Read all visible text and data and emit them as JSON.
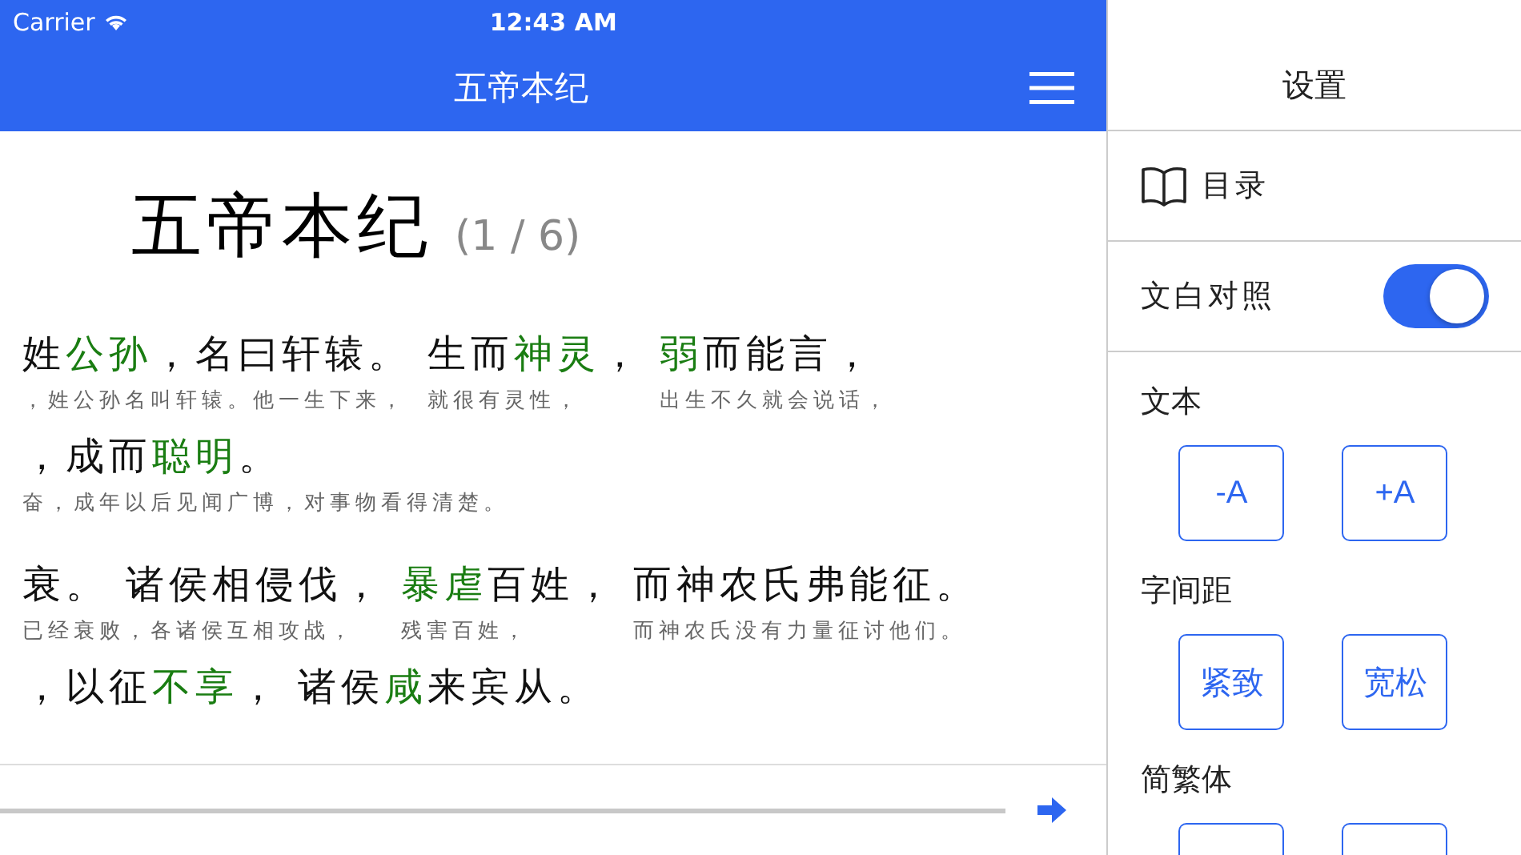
{
  "status_bar": {
    "carrier": "Carrier",
    "time": "12:43 AM"
  },
  "nav_bar": {
    "title": "五帝本纪"
  },
  "article": {
    "title": "五帝本纪",
    "page": "(1 / 6)",
    "paragraphs": [
      {
        "lines": [
          {
            "segments": [
              {
                "parts": [
                  {
                    "text": "姓",
                    "annotated": false
                  },
                  {
                    "text": "公孙",
                    "annotated": true
                  },
                  {
                    "text": "，名曰轩辕。",
                    "annotated": false
                  }
                ],
                "gloss": "，姓公孙名叫轩辕。他一生下来，"
              },
              {
                "parts": [
                  {
                    "text": "生而",
                    "annotated": false
                  },
                  {
                    "text": "神灵",
                    "annotated": true
                  },
                  {
                    "text": "，",
                    "annotated": false
                  }
                ],
                "gloss": "就很有灵性，"
              },
              {
                "parts": [
                  {
                    "text": "弱",
                    "annotated": true
                  },
                  {
                    "text": "而能言，",
                    "annotated": false
                  }
                ],
                "gloss": "出生不久就会说话，"
              }
            ]
          },
          {
            "segments": [
              {
                "parts": [
                  {
                    "text": "，成而",
                    "annotated": false
                  },
                  {
                    "text": "聪明",
                    "annotated": true
                  },
                  {
                    "text": "。",
                    "annotated": false
                  }
                ],
                "gloss": "奋，成年以后见闻广博，对事物看得清楚。"
              }
            ]
          }
        ]
      },
      {
        "lines": [
          {
            "segments": [
              {
                "parts": [
                  {
                    "text": "衰。 诸侯相侵伐，",
                    "annotated": false
                  }
                ],
                "gloss": "已经衰败，各诸侯互相攻战，"
              },
              {
                "parts": [
                  {
                    "text": "暴虐",
                    "annotated": true
                  },
                  {
                    "text": "百姓，",
                    "annotated": false
                  }
                ],
                "gloss": "残害百姓，"
              },
              {
                "parts": [
                  {
                    "text": "而神农氏弗能征。",
                    "annotated": false
                  }
                ],
                "gloss": "而神农氏没有力量征讨他们。"
              }
            ]
          },
          {
            "segments": [
              {
                "parts": [
                  {
                    "text": "，以征",
                    "annotated": false
                  },
                  {
                    "text": "不享",
                    "annotated": true
                  },
                  {
                    "text": "，",
                    "annotated": false
                  }
                ]
              },
              {
                "parts": [
                  {
                    "text": "诸侯",
                    "annotated": false
                  },
                  {
                    "text": "咸",
                    "annotated": true
                  },
                  {
                    "text": "来宾从。",
                    "annotated": false
                  }
                ]
              }
            ]
          }
        ]
      }
    ]
  },
  "settings": {
    "title": "设置",
    "contents": "目录",
    "parallel_text": {
      "label": "文白对照",
      "on": true
    },
    "sections": [
      {
        "label": "文本",
        "buttons": [
          {
            "label": "-A"
          },
          {
            "label": "+A"
          }
        ]
      },
      {
        "label": "字间距",
        "buttons": [
          {
            "label": "紧致"
          },
          {
            "label": "宽松"
          }
        ]
      },
      {
        "label": "简繁体",
        "buttons": [
          {
            "cut_off": true
          },
          {
            "cut_off": true
          }
        ]
      }
    ]
  }
}
